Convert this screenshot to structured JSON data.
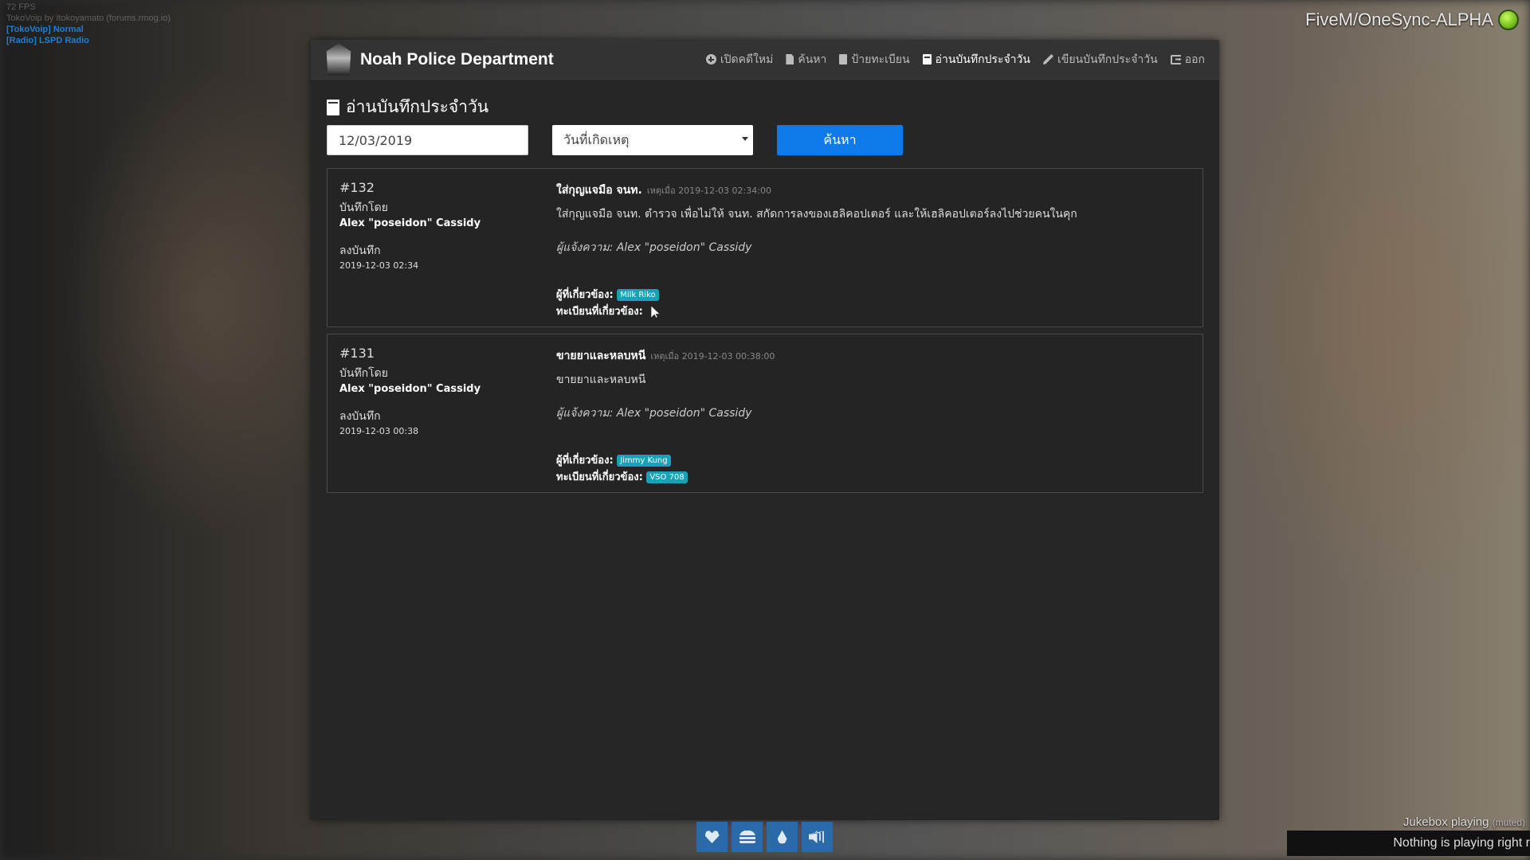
{
  "hud": {
    "fps": "72 FPS",
    "voice_line": "TokoVoip by Itokoyamato (forums.rmog.io)",
    "talk_mode": "[TokoVoip] Normal",
    "radio": "[Radio] LSPD Radio",
    "server_name": "FiveM/OneSync-ALPHA",
    "jukebox_label": "Jukebox playing",
    "jukebox_muted": "(muted)",
    "jukebox_status": "Nothing is playing right r",
    "bottom_icons": [
      "heart-icon",
      "burger-icon",
      "water-drop-icon",
      "speaker-icon"
    ]
  },
  "navbar": {
    "brand": "Noah Police Department",
    "links": [
      {
        "label": "เปิดคดีใหม่",
        "icon": "plus-circle-icon"
      },
      {
        "label": "ค้นหา",
        "icon": "file-icon"
      },
      {
        "label": "ป้ายทะเบียน",
        "icon": "trash-icon"
      },
      {
        "label": "อ่านบันทึกประจำวัน",
        "icon": "book-icon",
        "active": true
      },
      {
        "label": "เขียนบันทึกประจำวัน",
        "icon": "pencil-icon"
      },
      {
        "label": "ออก",
        "icon": "sign-out-icon"
      }
    ]
  },
  "page": {
    "heading": "อ่านบันทึกประจำวัน",
    "date_value": "12/03/2019",
    "select_value": "วันที่เกิดเหตุ",
    "search_button": "ค้นหา"
  },
  "records": [
    {
      "id": "#132",
      "recorded_by_label": "บันทึกโดย",
      "author": "Alex \"poseidon\" Cassidy",
      "logged_label": "ลงบันทึก",
      "logged_at": "2019-12-03 02:34",
      "title": "ใส่กุญแจมือ จนท.",
      "when": "เหตุเมื่อ 2019-12-03 02:34:00",
      "body": "ใส่กุญแจมือ จนท. ตำรวจ เพื่อไม่ให้ จนท. สกัดการลงของเฮลิคอปเตอร์ และให้เฮลิคอปเตอร์ลงไปช่วยคนในคุก",
      "reporter": "ผู้แจ้งความ: Alex \"poseidon\" Cassidy",
      "involved_label": "ผู้ที่เกี่ยวข้อง:",
      "involved": "Milk Riko",
      "plates_label": "ทะเบียนที่เกี่ยวข้อง:",
      "plates": ""
    },
    {
      "id": "#131",
      "recorded_by_label": "บันทึกโดย",
      "author": "Alex \"poseidon\" Cassidy",
      "logged_label": "ลงบันทึก",
      "logged_at": "2019-12-03 00:38",
      "title": "ขายยาและหลบหนี",
      "when": "เหตุเมื่อ 2019-12-03 00:38:00",
      "body": "ขายยาและหลบหนี",
      "reporter": "ผู้แจ้งความ: Alex \"poseidon\" Cassidy",
      "involved_label": "ผู้ที่เกี่ยวข้อง:",
      "involved": "Jimmy Kung",
      "plates_label": "ทะเบียนที่เกี่ยวข้อง:",
      "plates": "VSO 708"
    }
  ]
}
